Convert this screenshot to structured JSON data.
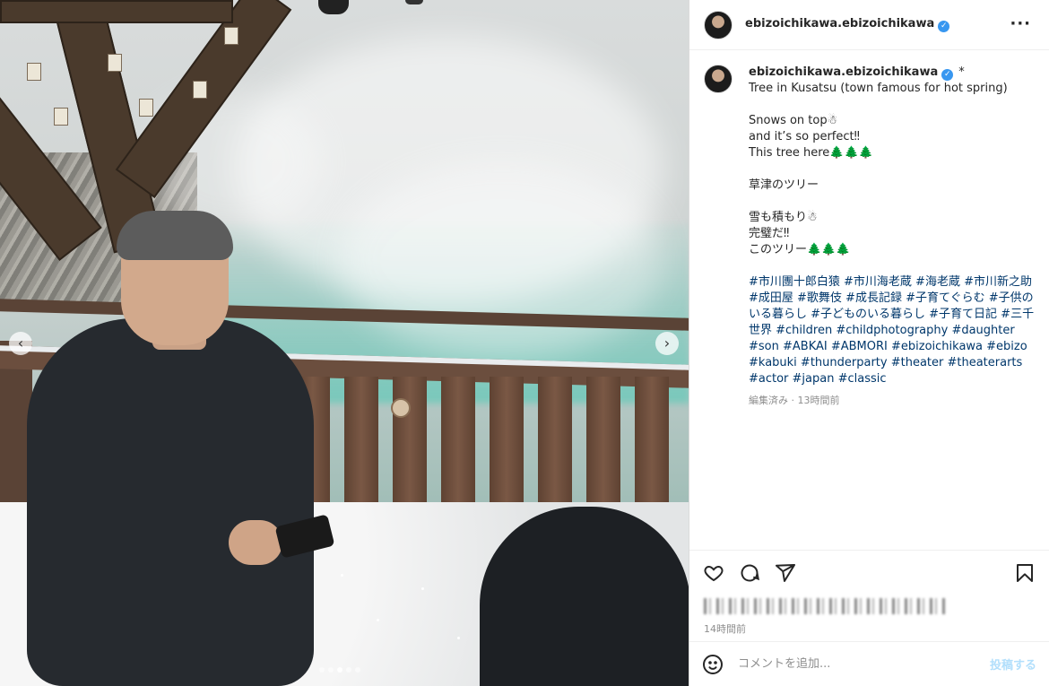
{
  "post": {
    "username": "ebizoichikawa.ebizoichikawa",
    "verified_icon": "verified-badge-icon",
    "more_icon": "more-options-icon"
  },
  "caption": {
    "username": "ebizoichikawa.ebizoichikawa",
    "marker": "*",
    "lines": [
      "Tree in Kusatsu (town famous for hot spring)",
      "",
      "Snows on top☃",
      "and it’s so perfect‼",
      "This tree here🌲🌲🌲",
      "",
      "草津のツリー",
      "",
      "雪も積もり☃",
      "完璧だ‼",
      "このツリー🌲🌲🌲",
      ""
    ],
    "hashtags": "#市川團十郎白猿 #市川海老蔵 #海老蔵 #市川新之助 #成田屋 #歌舞伎 #成長記録 #子育てぐらむ #子供のいる暮らし #子どものいる暮らし #子育て日記 #三千世界 #children #childphotography #daughter #son #ABKAI #ABMORI #ebizoichikawa #ebizo #kabuki #thunderparty #theater #theaterarts #actor #japan #classic",
    "meta": "編集済み · 13時間前"
  },
  "actions": {
    "like_icon": "heart-icon",
    "comment_icon": "comment-icon",
    "share_icon": "share-icon",
    "save_icon": "bookmark-icon"
  },
  "time": "14時間前",
  "comment": {
    "placeholder": "コメントを追加...",
    "post_label": "投稿する",
    "emoji_icon": "emoji-icon"
  },
  "carousel": {
    "prev_arrow": "‹",
    "next_arrow": "›",
    "total_slides": 5,
    "active_slide": 3
  }
}
